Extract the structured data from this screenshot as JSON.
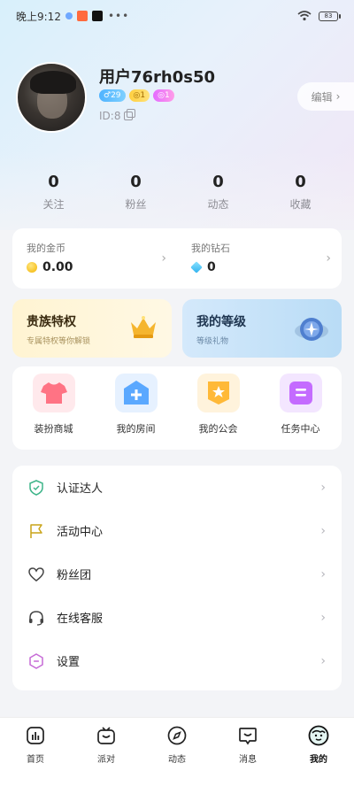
{
  "status_bar": {
    "time": "晚上9:12",
    "dots": "•••",
    "battery": "83"
  },
  "profile": {
    "username": "用户76rh0s50",
    "badges": [
      {
        "text": "♂29",
        "color": "#4fb3ff"
      },
      {
        "text": "◎1",
        "color": "#ffcf3f"
      },
      {
        "text": "◎1",
        "color": "#e46bff"
      }
    ],
    "user_id": "ID:8",
    "edit_label": "编辑",
    "edit_chevron": "›"
  },
  "stats": [
    {
      "value": "0",
      "label": "关注"
    },
    {
      "value": "0",
      "label": "粉丝"
    },
    {
      "value": "0",
      "label": "动态"
    },
    {
      "value": "0",
      "label": "收藏"
    }
  ],
  "wallet": {
    "coins": {
      "label": "我的金币",
      "value": "0.00",
      "icon": "coin-icon"
    },
    "diamonds": {
      "label": "我的钻石",
      "value": "0",
      "icon": "diamond-icon"
    },
    "chevron": "›"
  },
  "privilege": {
    "noble": {
      "title": "贵族特权",
      "subtitle": "专属特权等你解锁",
      "icon": "crown-icon"
    },
    "level": {
      "title": "我的等级",
      "subtitle": "等级礼物",
      "icon": "level-badge-icon"
    }
  },
  "shortcuts": [
    {
      "label": "装扮商城",
      "icon": "shirt-icon",
      "color": "#ff6f7f",
      "bg": "#ffe9ec"
    },
    {
      "label": "我的房间",
      "icon": "room-plus-icon",
      "color": "#5aa8ff",
      "bg": "#e6f1ff"
    },
    {
      "label": "我的公会",
      "icon": "guild-flag-icon",
      "color": "#ffb938",
      "bg": "#fff3dc"
    },
    {
      "label": "任务中心",
      "icon": "task-icon",
      "color": "#c46bff",
      "bg": "#f3e6ff"
    }
  ],
  "menu": [
    {
      "label": "认证达人",
      "icon": "shield-check-icon"
    },
    {
      "label": "活动中心",
      "icon": "flag-icon"
    },
    {
      "label": "粉丝团",
      "icon": "heart-icon"
    },
    {
      "label": "在线客服",
      "icon": "headset-icon"
    },
    {
      "label": "设置",
      "icon": "settings-hexagon-icon"
    }
  ],
  "menu_chevron": "›",
  "tabs": [
    {
      "label": "首页",
      "icon": "home-chart-icon",
      "active": false
    },
    {
      "label": "派对",
      "icon": "tv-icon",
      "active": false
    },
    {
      "label": "动态",
      "icon": "compass-icon",
      "active": false
    },
    {
      "label": "消息",
      "icon": "message-icon",
      "active": false
    },
    {
      "label": "我的",
      "icon": "profile-face-icon",
      "active": true
    }
  ]
}
